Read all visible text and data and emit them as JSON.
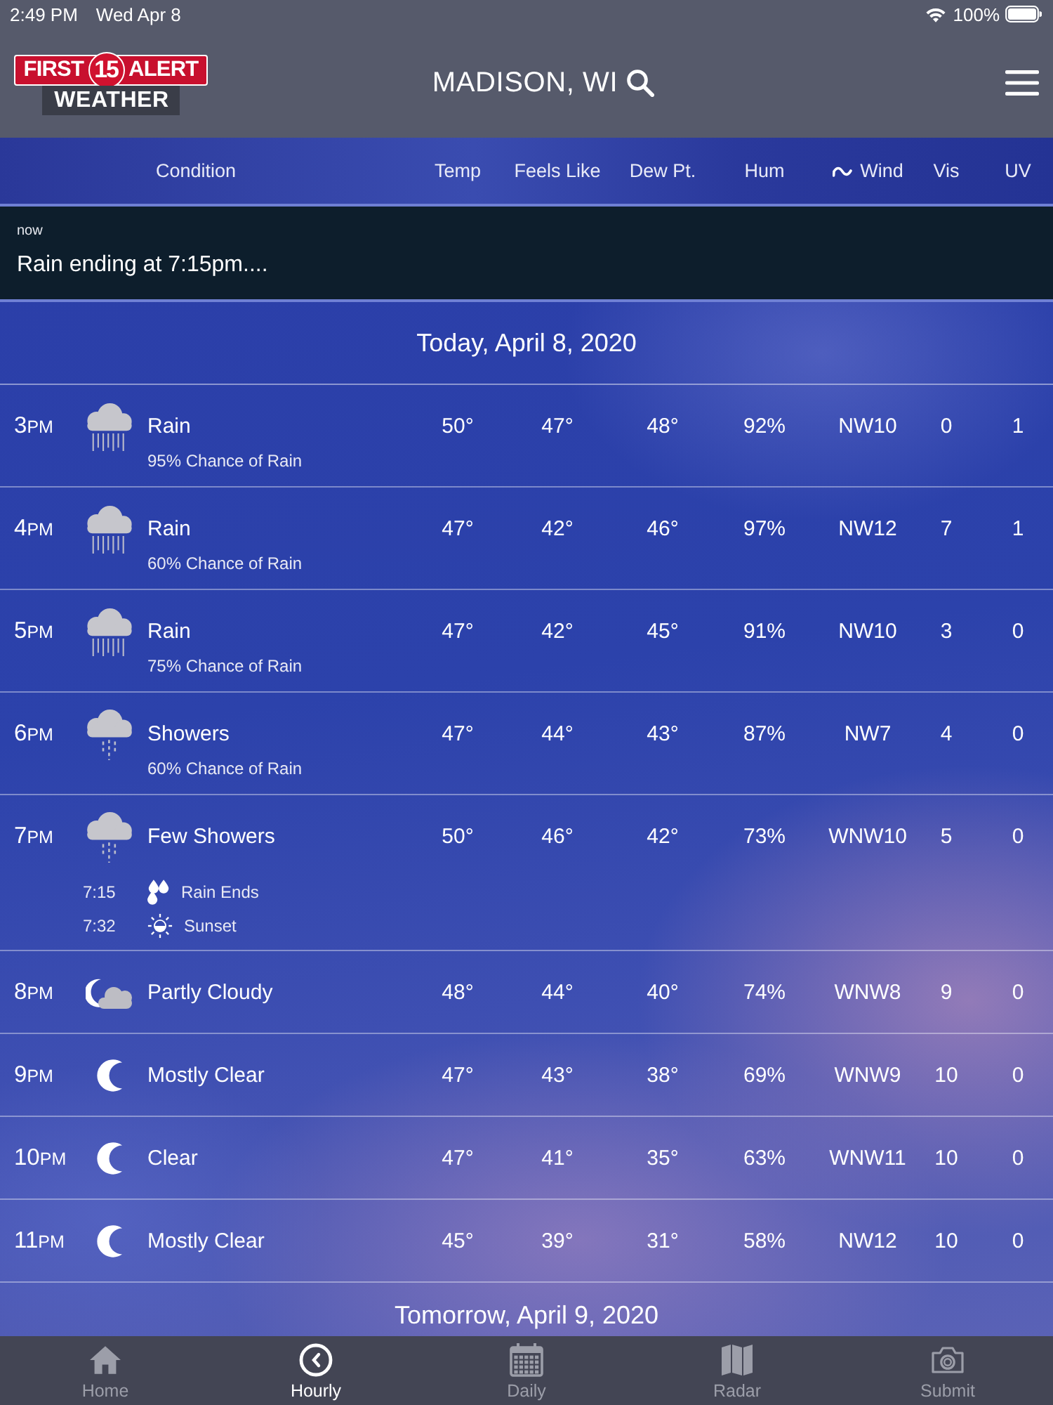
{
  "status_bar": {
    "time": "2:49 PM",
    "date": "Wed Apr 8",
    "battery": "100%"
  },
  "header": {
    "logo": {
      "left": "FIRST",
      "number": "15",
      "right": "ALERT",
      "subtitle": "WEATHER"
    },
    "location": "MADISON, WI"
  },
  "columns": [
    {
      "label": "Condition",
      "kind": "condition"
    },
    {
      "label": "Temp",
      "kind": "value"
    },
    {
      "label": "Feels Like",
      "kind": "value"
    },
    {
      "label": "Dew Pt.",
      "kind": "value"
    },
    {
      "label": "Hum",
      "kind": "value"
    },
    {
      "label": "Wind",
      "kind": "wind"
    },
    {
      "label": "Vis",
      "kind": "value"
    },
    {
      "label": "UV",
      "kind": "value"
    }
  ],
  "alert": {
    "time": "now",
    "message": "Rain ending at 7:15pm...."
  },
  "days": [
    {
      "title": "Today, April 8, 2020",
      "hours": [
        {
          "hour": "3",
          "period": "PM",
          "kind": "rain",
          "condition": "Rain",
          "detail": "95% Chance of Rain",
          "temp": "50°",
          "feels_like": "47°",
          "dew_point": "48°",
          "humidity": "92%",
          "wind": "NW10",
          "visibility": "0",
          "uv": "1"
        },
        {
          "hour": "4",
          "period": "PM",
          "kind": "rain",
          "condition": "Rain",
          "detail": "60% Chance of Rain",
          "temp": "47°",
          "feels_like": "42°",
          "dew_point": "46°",
          "humidity": "97%",
          "wind": "NW12",
          "visibility": "7",
          "uv": "1"
        },
        {
          "hour": "5",
          "period": "PM",
          "kind": "rain",
          "condition": "Rain",
          "detail": "75% Chance of Rain",
          "temp": "47°",
          "feels_like": "42°",
          "dew_point": "45°",
          "humidity": "91%",
          "wind": "NW10",
          "visibility": "3",
          "uv": "0"
        },
        {
          "hour": "6",
          "period": "PM",
          "kind": "showers",
          "condition": "Showers",
          "detail": "60% Chance of Rain",
          "temp": "47°",
          "feels_like": "44°",
          "dew_point": "43°",
          "humidity": "87%",
          "wind": "NW7",
          "visibility": "4",
          "uv": "0"
        },
        {
          "hour": "7",
          "period": "PM",
          "kind": "showers",
          "condition": "Few Showers",
          "temp": "50°",
          "feels_like": "46°",
          "dew_point": "42°",
          "humidity": "73%",
          "wind": "WNW10",
          "visibility": "5",
          "uv": "0",
          "events": [
            {
              "time": "7:15",
              "kind": "raindrops",
              "label": "Rain Ends"
            },
            {
              "time": "7:32",
              "kind": "sunset",
              "label": "Sunset"
            }
          ]
        },
        {
          "hour": "8",
          "period": "PM",
          "kind": "partly-cloudy-night",
          "condition": "Partly Cloudy",
          "temp": "48°",
          "feels_like": "44°",
          "dew_point": "40°",
          "humidity": "74%",
          "wind": "WNW8",
          "visibility": "9",
          "uv": "0"
        },
        {
          "hour": "9",
          "period": "PM",
          "kind": "clear-night",
          "condition": "Mostly Clear",
          "temp": "47°",
          "feels_like": "43°",
          "dew_point": "38°",
          "humidity": "69%",
          "wind": "WNW9",
          "visibility": "10",
          "uv": "0"
        },
        {
          "hour": "10",
          "period": "PM",
          "kind": "clear-night",
          "condition": "Clear",
          "temp": "47°",
          "feels_like": "41°",
          "dew_point": "35°",
          "humidity": "63%",
          "wind": "WNW11",
          "visibility": "10",
          "uv": "0"
        },
        {
          "hour": "11",
          "period": "PM",
          "kind": "clear-night",
          "condition": "Mostly Clear",
          "temp": "45°",
          "feels_like": "39°",
          "dew_point": "31°",
          "humidity": "58%",
          "wind": "NW12",
          "visibility": "10",
          "uv": "0"
        }
      ]
    },
    {
      "title": "Tomorrow, April 9, 2020"
    }
  ],
  "tabs": [
    {
      "label": "Home",
      "kind": "house",
      "selected": false
    },
    {
      "label": "Hourly",
      "kind": "clock",
      "selected": true
    },
    {
      "label": "Daily",
      "kind": "calendar",
      "selected": false
    },
    {
      "label": "Radar",
      "kind": "map",
      "selected": false
    },
    {
      "label": "Submit",
      "kind": "camera",
      "selected": false
    }
  ]
}
